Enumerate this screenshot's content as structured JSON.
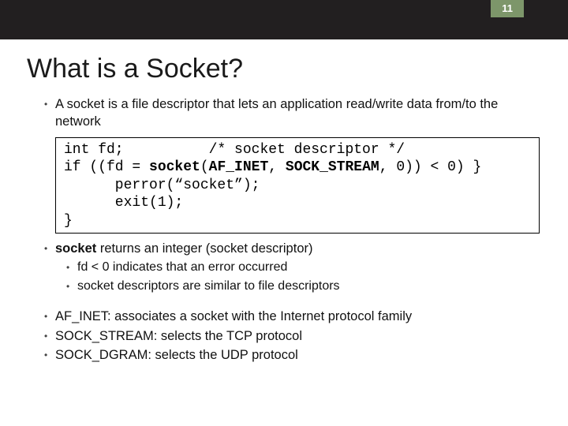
{
  "page_number": "11",
  "title": "What is a Socket?",
  "intro": "A socket is a file descriptor that lets an application read/write data from/to the network",
  "code": {
    "line1a": "int fd;          /* socket descriptor */",
    "line2a": "if ((fd = ",
    "line2b": "socket",
    "line2c": "(",
    "line2d": "AF_INET",
    "line2e": ", ",
    "line2f": "SOCK_STREAM",
    "line2g": ", 0)) < 0) }",
    "line3": "      perror(“socket”);",
    "line4": "      exit(1);",
    "line5": "}"
  },
  "returns": {
    "lead_bold": "socket",
    "lead_rest": " returns an integer (socket descriptor)",
    "sub1": "fd < 0 indicates that an error occurred",
    "sub2": "socket descriptors are similar to file descriptors"
  },
  "consts": {
    "c1": "AF_INET: associates a socket with the Internet protocol family",
    "c2": "SOCK_STREAM: selects the TCP protocol",
    "c3": "SOCK_DGRAM: selects the UDP protocol"
  }
}
